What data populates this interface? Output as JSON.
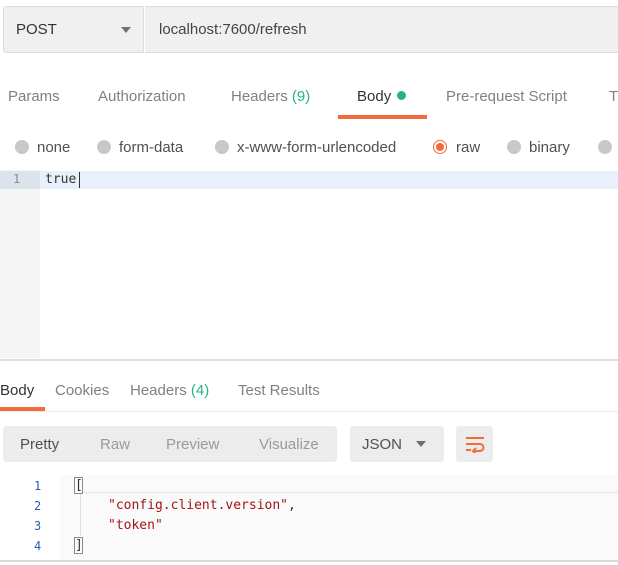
{
  "request": {
    "method": "POST",
    "url": "localhost:7600/refresh"
  },
  "request_tabs": [
    {
      "label": "Params"
    },
    {
      "label": "Authorization"
    },
    {
      "label": "Headers",
      "count": "(9)"
    },
    {
      "label": "Body"
    },
    {
      "label": "Pre-request Script"
    },
    {
      "label": "T"
    }
  ],
  "body_types": [
    "none",
    "form-data",
    "x-www-form-urlencoded",
    "raw",
    "binary"
  ],
  "body_type_selected": "raw",
  "editor": {
    "line_number": "1",
    "content": "true"
  },
  "response_tabs": [
    {
      "label": "Body"
    },
    {
      "label": "Cookies"
    },
    {
      "label": "Headers",
      "count": "(4)"
    },
    {
      "label": "Test Results"
    }
  ],
  "view_modes": [
    "Pretty",
    "Raw",
    "Preview",
    "Visualize"
  ],
  "view_mode_selected": "Pretty",
  "format": "JSON",
  "response": {
    "line_numbers": [
      "1",
      "2",
      "3",
      "4"
    ],
    "open_bracket": "[",
    "items": [
      "\"config.client.version\"",
      "\"token\""
    ],
    "comma": ",",
    "close_bracket": "]"
  },
  "colors": {
    "accent": "#f26b3a",
    "count_green": "#26b47f"
  },
  "icons": {
    "wrap": "wrap-lines-icon"
  }
}
